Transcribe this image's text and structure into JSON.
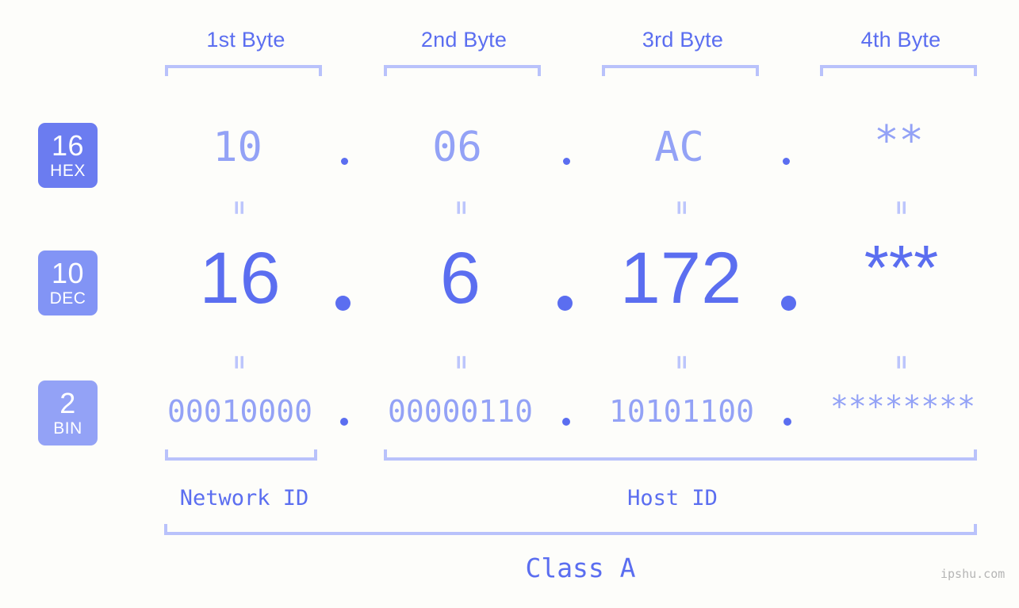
{
  "headers": [
    {
      "label": "1st Byte"
    },
    {
      "label": "2nd Byte"
    },
    {
      "label": "3rd Byte"
    },
    {
      "label": "4th Byte"
    }
  ],
  "bases": [
    {
      "number": "16",
      "name": "HEX",
      "color": "#6b7cf0"
    },
    {
      "number": "10",
      "name": "DEC",
      "color": "#8294f5"
    },
    {
      "number": "2",
      "name": "BIN",
      "color": "#93a2f6"
    }
  ],
  "rows": {
    "hex": {
      "base_number": "16",
      "base_name": "HEX",
      "bytes": [
        "10",
        "06",
        "AC",
        "**"
      ]
    },
    "dec": {
      "base_number": "10",
      "base_name": "DEC",
      "bytes": [
        "16",
        "6",
        "172",
        "***"
      ]
    },
    "bin": {
      "base_number": "2",
      "base_name": "BIN",
      "bytes": [
        "00010000",
        "00000110",
        "10101100",
        "********"
      ]
    }
  },
  "separator": ".",
  "equals": "=",
  "sections": {
    "network_id": "Network ID",
    "host_id": "Host ID",
    "class": "Class A"
  },
  "watermark": "ipshu.com",
  "colors": {
    "accent": "#5b6ef0",
    "accent_light": "#93a2f6",
    "bracket": "#b9c2fb",
    "equals": "#bcc5fc",
    "background": "#fdfdfa",
    "watermark": "#b5b5b5"
  }
}
